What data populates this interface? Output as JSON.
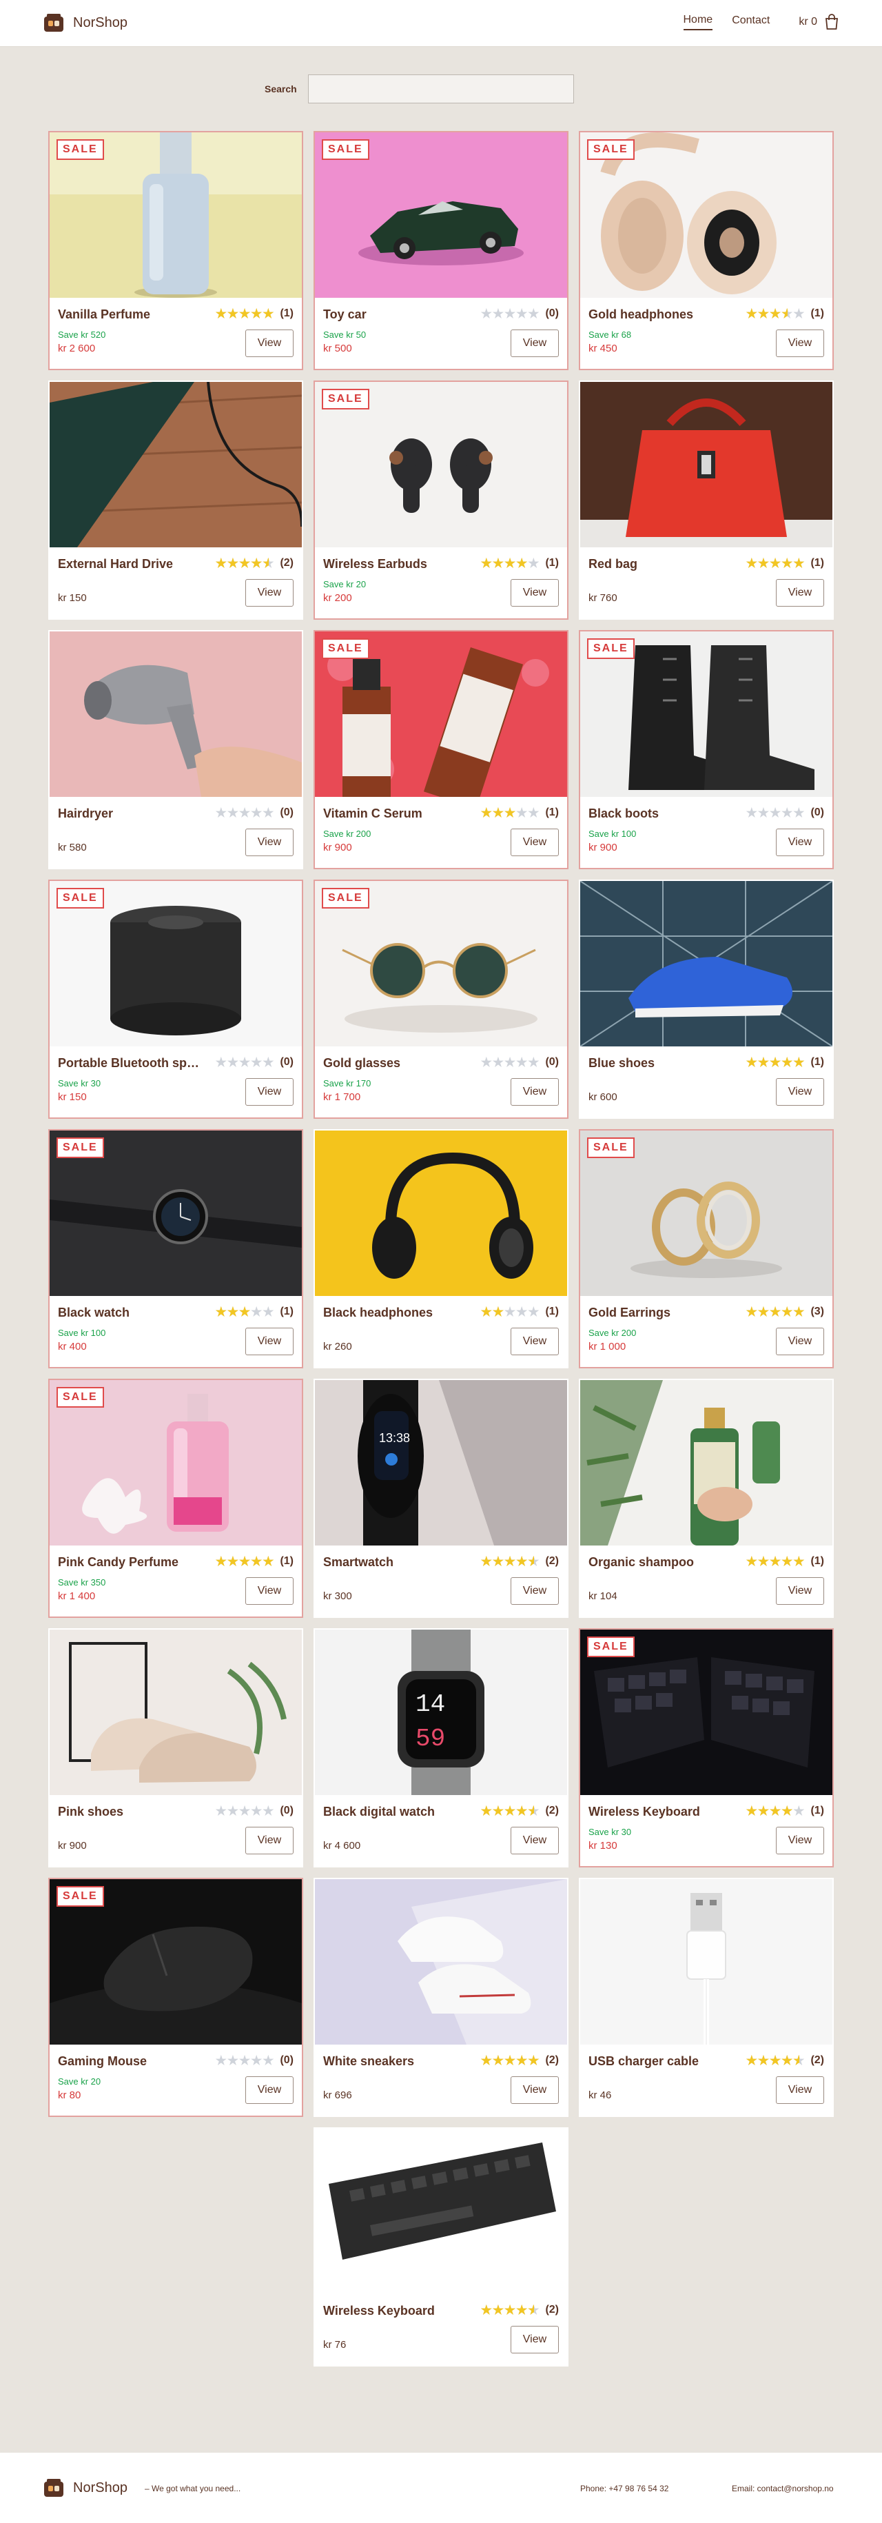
{
  "brand": {
    "name": "NorShop"
  },
  "nav": {
    "home": "Home",
    "contact": "Contact",
    "cart_total": "kr 0"
  },
  "search": {
    "label": "Search",
    "placeholder": ""
  },
  "products": [
    {
      "name": "Vanilla Perfume",
      "rating": 5,
      "reviews": "(1)",
      "sale": true,
      "save": "Save kr 520",
      "price": "kr 2 600",
      "image": "vanilla-perfume-image"
    },
    {
      "name": "Toy car",
      "rating": 0,
      "reviews": "(0)",
      "sale": true,
      "save": "Save kr 50",
      "price": "kr 500",
      "image": "toy-car-image"
    },
    {
      "name": "Gold headphones",
      "rating": 3.5,
      "reviews": "(1)",
      "sale": true,
      "save": "Save kr 68",
      "price": "kr 450",
      "image": "gold-headphones-image"
    },
    {
      "name": "External Hard Drive",
      "rating": 4.5,
      "reviews": "(2)",
      "sale": false,
      "save": "",
      "price": "kr 150",
      "image": "hard-drive-image"
    },
    {
      "name": "Wireless Earbuds",
      "rating": 4,
      "reviews": "(1)",
      "sale": true,
      "save": "Save kr 20",
      "price": "kr 200",
      "image": "earbuds-image"
    },
    {
      "name": "Red bag",
      "rating": 5,
      "reviews": "(1)",
      "sale": false,
      "save": "",
      "price": "kr 760",
      "image": "red-bag-image"
    },
    {
      "name": "Hairdryer",
      "rating": 0,
      "reviews": "(0)",
      "sale": false,
      "save": "",
      "price": "kr 580",
      "image": "hairdryer-image"
    },
    {
      "name": "Vitamin C Serum",
      "rating": 3,
      "reviews": "(1)",
      "sale": true,
      "save": "Save kr 200",
      "price": "kr 900",
      "image": "serum-image"
    },
    {
      "name": "Black boots",
      "rating": 0,
      "reviews": "(0)",
      "sale": true,
      "save": "Save kr 100",
      "price": "kr 900",
      "image": "black-boots-image"
    },
    {
      "name": "Portable Bluetooth speaker",
      "rating": 0,
      "reviews": "(0)",
      "sale": true,
      "save": "Save kr 30",
      "price": "kr 150",
      "image": "speaker-image"
    },
    {
      "name": "Gold glasses",
      "rating": 0,
      "reviews": "(0)",
      "sale": true,
      "save": "Save kr 170",
      "price": "kr 1 700",
      "image": "gold-glasses-image"
    },
    {
      "name": "Blue shoes",
      "rating": 5,
      "reviews": "(1)",
      "sale": false,
      "save": "",
      "price": "kr 600",
      "image": "blue-shoes-image"
    },
    {
      "name": "Black watch",
      "rating": 3,
      "reviews": "(1)",
      "sale": true,
      "save": "Save kr 100",
      "price": "kr 400",
      "image": "black-watch-image"
    },
    {
      "name": "Black headphones",
      "rating": 2,
      "reviews": "(1)",
      "sale": false,
      "save": "",
      "price": "kr 260",
      "image": "black-headphones-image"
    },
    {
      "name": "Gold Earrings",
      "rating": 5,
      "reviews": "(3)",
      "sale": true,
      "save": "Save kr 200",
      "price": "kr 1 000",
      "image": "gold-earrings-image"
    },
    {
      "name": "Pink Candy Perfume",
      "rating": 5,
      "reviews": "(1)",
      "sale": true,
      "save": "Save kr 350",
      "price": "kr 1 400",
      "image": "pink-perfume-image"
    },
    {
      "name": "Smartwatch",
      "rating": 4.5,
      "reviews": "(2)",
      "sale": false,
      "save": "",
      "price": "kr 300",
      "image": "smartwatch-image"
    },
    {
      "name": "Organic shampoo",
      "rating": 5,
      "reviews": "(1)",
      "sale": false,
      "save": "",
      "price": "kr 104",
      "image": "shampoo-image"
    },
    {
      "name": "Pink shoes",
      "rating": 0,
      "reviews": "(0)",
      "sale": false,
      "save": "",
      "price": "kr 900",
      "image": "pink-shoes-image"
    },
    {
      "name": "Black digital watch",
      "rating": 4.5,
      "reviews": "(2)",
      "sale": false,
      "save": "",
      "price": "kr 4 600",
      "image": "digital-watch-image"
    },
    {
      "name": "Wireless Keyboard",
      "rating": 4,
      "reviews": "(1)",
      "sale": true,
      "save": "Save kr 30",
      "price": "kr 130",
      "image": "split-keyboard-image"
    },
    {
      "name": "Gaming Mouse",
      "rating": 0,
      "reviews": "(0)",
      "sale": true,
      "save": "Save kr 20",
      "price": "kr 80",
      "image": "gaming-mouse-image"
    },
    {
      "name": "White sneakers",
      "rating": 5,
      "reviews": "(2)",
      "sale": false,
      "save": "",
      "price": "kr 696",
      "image": "white-sneakers-image"
    },
    {
      "name": "USB charger cable",
      "rating": 4.5,
      "reviews": "(2)",
      "sale": false,
      "save": "",
      "price": "kr 46",
      "image": "usb-cable-image"
    },
    {
      "name": "Wireless Keyboard",
      "rating": 4.5,
      "reviews": "(2)",
      "sale": false,
      "save": "",
      "price": "kr 76",
      "image": "keyboard-image"
    }
  ],
  "labels": {
    "sale": "SALE",
    "view": "View"
  },
  "footer": {
    "tagline": "– We got what you need...",
    "phone": "Phone: +47 98 76 54 32",
    "email": "Email: contact@norshop.no"
  },
  "colors": {
    "background": "#e8e4de",
    "text": "#5a3324",
    "sale": "#d63a3a",
    "save": "#1aa24a",
    "star": "#f2c623"
  }
}
